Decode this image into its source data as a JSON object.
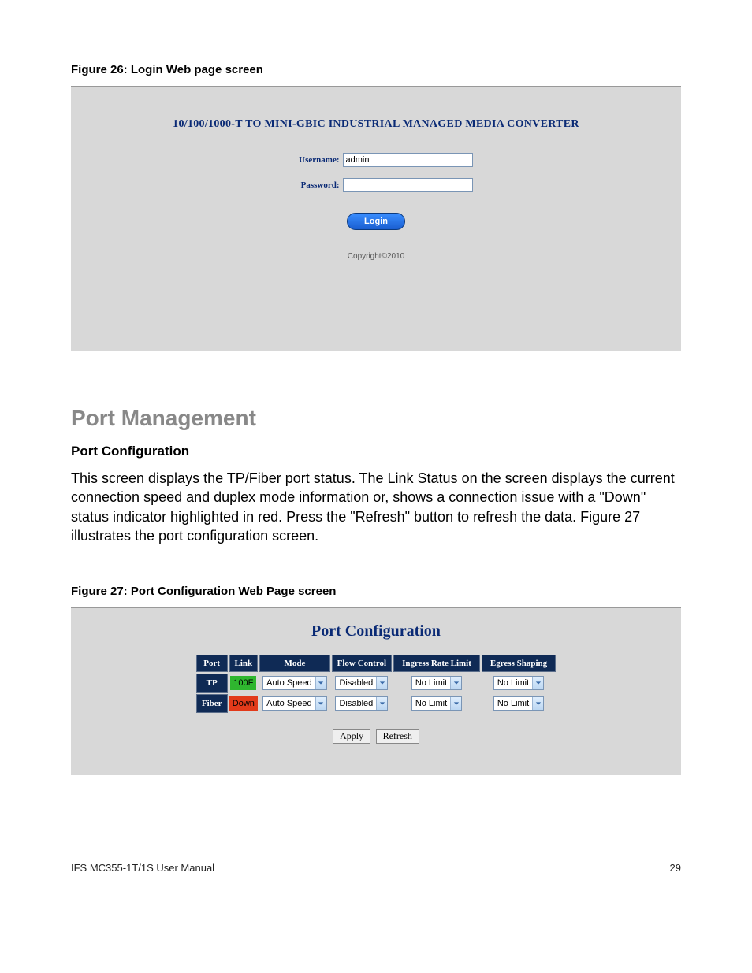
{
  "figure26": {
    "caption": "Figure 26: Login Web page screen",
    "title": "10/100/1000-T TO MINI-GBIC INDUSTRIAL MANAGED MEDIA CONVERTER",
    "username_label": "Username:",
    "username_value": "admin",
    "password_label": "Password:",
    "password_value": "",
    "login_button": "Login",
    "copyright": "Copyright©2010"
  },
  "section": {
    "title": "Port Management",
    "sub": "Port Configuration",
    "body": "This screen displays the TP/Fiber port status. The Link Status on the screen displays the current connection speed and duplex mode information or, shows a connection issue with a \"Down\" status indicator highlighted in red. Press the \"Refresh\" button to refresh the data. Figure 27 illustrates the port configuration screen."
  },
  "figure27": {
    "caption": "Figure 27: Port Configuration Web Page screen",
    "title": "Port Configuration",
    "columns": {
      "port": "Port",
      "link": "Link",
      "mode": "Mode",
      "flow": "Flow Control",
      "ingress": "Ingress Rate Limit",
      "egress": "Egress Shaping"
    },
    "rows": [
      {
        "port": "TP",
        "link": "100F",
        "link_state": "up",
        "mode": "Auto Speed",
        "flow": "Disabled",
        "ingress": "No Limit",
        "egress": "No Limit"
      },
      {
        "port": "Fiber",
        "link": "Down",
        "link_state": "down",
        "mode": "Auto Speed",
        "flow": "Disabled",
        "ingress": "No Limit",
        "egress": "No Limit"
      }
    ],
    "apply": "Apply",
    "refresh": "Refresh"
  },
  "footer": {
    "left": "IFS MC355-1T/1S User Manual",
    "right": "29"
  }
}
